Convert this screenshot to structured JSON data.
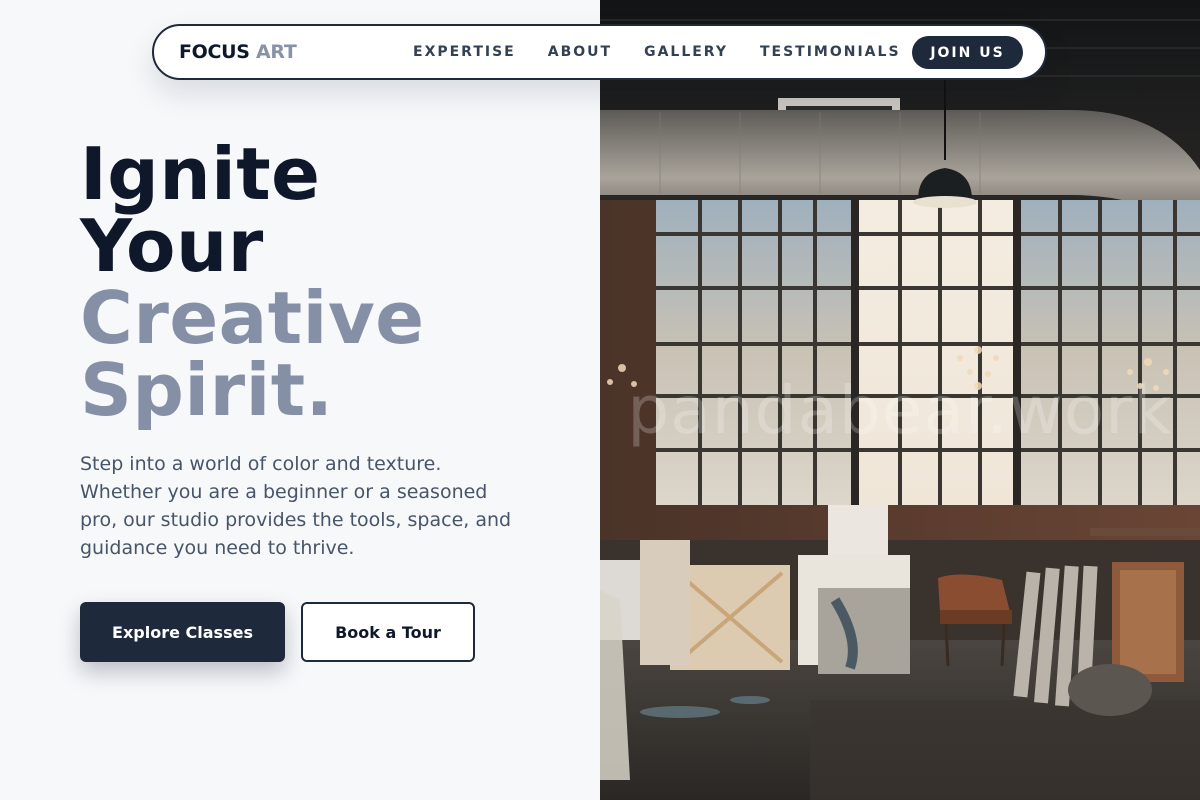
{
  "nav": {
    "brand_primary": "FOCUS",
    "brand_accent": "ART",
    "links": [
      "EXPERTISE",
      "ABOUT",
      "GALLERY",
      "TESTIMONIALS"
    ],
    "cta": "JOIN US"
  },
  "hero": {
    "headline_line1": "Ignite",
    "headline_line2": "Your",
    "headline_line3": "Creative",
    "headline_line4": "Spirit.",
    "description": "Step into a world of color and texture. Whether you are a beginner or a seasoned pro, our studio provides the tools, space, and guidance you need to thrive.",
    "primary_button": "Explore Classes",
    "secondary_button": "Book a Tour"
  },
  "image": {
    "watermark": "pandabear.work"
  },
  "colors": {
    "background": "#f6f8fa",
    "dark": "#0f172a",
    "button_dark": "#1e293b",
    "muted_headline": "#8590a6",
    "body_text": "#475569"
  }
}
